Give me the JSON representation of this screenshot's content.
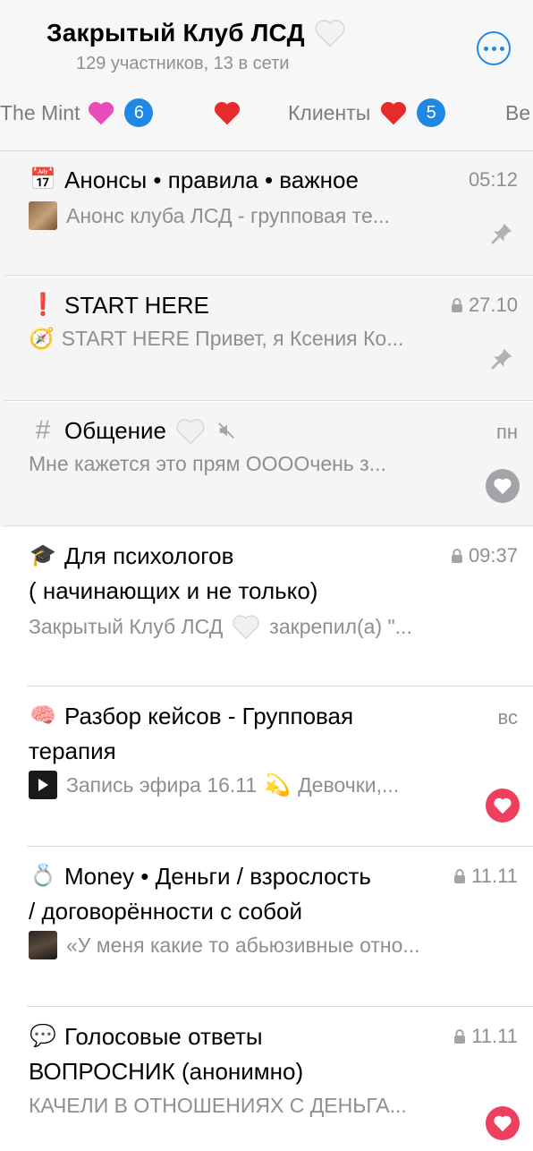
{
  "header": {
    "title": "Закрытый Клуб ЛСД",
    "subtitle": "129 участников, 13 в сети",
    "more_icon": "ellipsis-circle-icon",
    "accent": "#1e88e5"
  },
  "tabs": [
    {
      "label": "The Mint",
      "icon": "pink-heart-icon",
      "badge": "6"
    },
    {
      "label": "",
      "icon": "red-heart-icon",
      "badge": ""
    },
    {
      "label": "Клиенты",
      "icon": "red-heart-icon",
      "badge": "5"
    },
    {
      "label": "Ве",
      "icon": "",
      "badge": ""
    }
  ],
  "chats": [
    {
      "icon": "📅",
      "title": "Анонсы • правила • важное",
      "time": "05:12",
      "preview": "Анонс клуба ЛСД - групповая те...",
      "pinned": true
    },
    {
      "icon": "❗",
      "title": "START HERE",
      "time": "27.10",
      "locked": true,
      "preview_emoji": "🧭",
      "preview": "START HERE Привет, я Ксения Ко...",
      "pinned": true
    },
    {
      "icon": "#",
      "title": "Общение",
      "time": "пн",
      "muted": true,
      "preview": "Мне кажется это прям ОООOчень з...",
      "reaction": "gray-heart"
    },
    {
      "icon": "🎓",
      "title": "Для психологов",
      "title2": "( начинающих и не только)",
      "time": "09:37",
      "locked": true,
      "preview": "Закрытый Клуб ЛСД",
      "preview_tail": "закрепил(а) \"..."
    },
    {
      "icon": "🧠",
      "title": "Разбор кейсов - Групповая",
      "title2": "терапия",
      "time": "вс",
      "preview": "Запись эфира 16.11",
      "preview_tail": "Девочки,...",
      "reaction": "red-heart"
    },
    {
      "icon": "💍",
      "title": "Money • Деньги / взрослость",
      "title2": "/ договорённости с собой",
      "time": "11.11",
      "locked": true,
      "preview": "«У меня какие то абьюзивные отно..."
    },
    {
      "icon": "💬",
      "title": "Голосовые ответы",
      "title2": "ВОПРОСНИК (анонимно)",
      "time": "11.11",
      "locked": true,
      "preview": "КАЧЕЛИ В ОТНОШЕНИЯХ С ДЕНЬГА...",
      "reaction": "red-heart"
    }
  ]
}
